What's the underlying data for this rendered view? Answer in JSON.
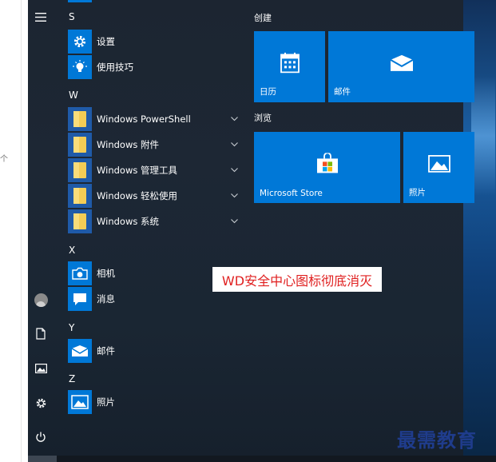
{
  "colors": {
    "start_background": "#1c2531",
    "tile_blue": "#0078d7",
    "caption_text": "#e02020",
    "brand_text": "#1f3c8c"
  },
  "left_strip": {
    "glyph": "个"
  },
  "rail": {
    "menu_icon": "hamburger-icon",
    "user_icon": "avatar-icon",
    "documents_icon": "document-icon",
    "pictures_icon": "picture-icon",
    "settings_icon": "gear-icon",
    "power_icon": "power-icon"
  },
  "app_list": {
    "sections": [
      {
        "letter": "S",
        "items": [
          {
            "label": "设置",
            "icon": "gear-icon"
          },
          {
            "label": "使用技巧",
            "icon": "lightbulb-icon"
          }
        ]
      },
      {
        "letter": "W",
        "items": [
          {
            "label": "Windows PowerShell",
            "icon": "folder-icon",
            "expandable": true
          },
          {
            "label": "Windows 附件",
            "icon": "folder-icon",
            "expandable": true
          },
          {
            "label": "Windows 管理工具",
            "icon": "folder-icon",
            "expandable": true
          },
          {
            "label": "Windows 轻松使用",
            "icon": "folder-icon",
            "expandable": true
          },
          {
            "label": "Windows 系统",
            "icon": "folder-icon",
            "expandable": true
          }
        ]
      },
      {
        "letter": "X",
        "items": [
          {
            "label": "相机",
            "icon": "camera-icon"
          },
          {
            "label": "消息",
            "icon": "message-icon"
          }
        ]
      },
      {
        "letter": "Y",
        "items": [
          {
            "label": "邮件",
            "icon": "mail-icon"
          }
        ]
      },
      {
        "letter": "Z",
        "items": [
          {
            "label": "照片",
            "icon": "photo-icon"
          }
        ]
      }
    ]
  },
  "tiles": {
    "groups": [
      {
        "title": "创建",
        "tiles": [
          {
            "label": "日历",
            "icon": "calendar-icon"
          },
          {
            "label": "邮件",
            "icon": "mail-icon"
          }
        ]
      },
      {
        "title": "浏览",
        "tiles": [
          {
            "label": "Microsoft Store",
            "icon": "store-icon"
          },
          {
            "label": "照片",
            "icon": "photo-icon"
          }
        ]
      }
    ]
  },
  "overlay": {
    "caption": "WD安全中心图标彻底消灭",
    "brand": "最需教育"
  }
}
